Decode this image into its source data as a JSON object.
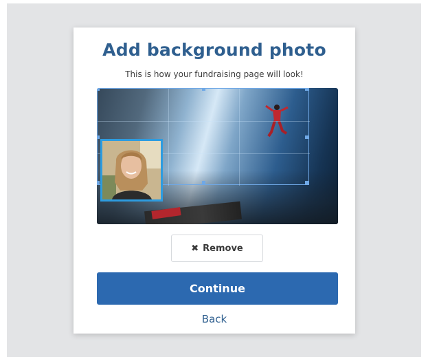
{
  "modal": {
    "title": "Add background photo",
    "subtitle": "This is how your fundraising page will look!"
  },
  "preview": {
    "image": "skydiving background photo",
    "profile_image": "profile photo of smiling woman"
  },
  "buttons": {
    "remove_label": "Remove",
    "remove_icon": "close-icon",
    "continue_label": "Continue",
    "back_label": "Back"
  },
  "colors": {
    "title": "#2f5f8f",
    "primary_button": "#2c69b0",
    "avatar_border": "#2d9ce0",
    "crop_border": "#6fa8e6",
    "backdrop": "#e3e4e6"
  }
}
